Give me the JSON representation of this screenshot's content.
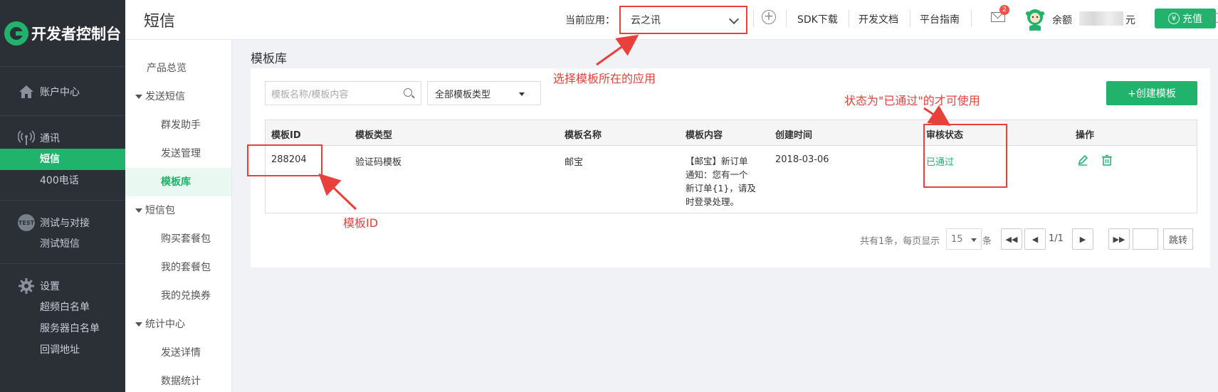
{
  "sidebar": {
    "logo_text": "开发者控制台",
    "groups": [
      {
        "label": "账户中心",
        "icon": "house-icon",
        "items": []
      },
      {
        "label": "通讯",
        "icon": "signal-icon",
        "items": [
          "短信",
          "400电话"
        ]
      },
      {
        "label": "测试与对接",
        "icon": "test-badge-icon",
        "badge": "TEST",
        "items": [
          "测试短信"
        ]
      },
      {
        "label": "设置",
        "icon": "gear-icon",
        "items": [
          "超频白名单",
          "服务器白名单",
          "回调地址"
        ]
      }
    ],
    "active_item": "短信"
  },
  "header": {
    "title": "短信",
    "current_app_label": "当前应用：",
    "current_app_value": "云之讯",
    "links": [
      "SDK下载",
      "开发文档",
      "平台指南"
    ],
    "mail_badge": "2",
    "balance_label": "余额",
    "balance_unit": "元",
    "recharge_label": "充值",
    "recharge_icon_glyph": "¥"
  },
  "submenu": {
    "items": [
      {
        "label": "产品总览",
        "level": 1
      },
      {
        "label": "发送短信",
        "level": 0
      },
      {
        "label": "群发助手",
        "level": 2
      },
      {
        "label": "发送管理",
        "level": 2
      },
      {
        "label": "模板库",
        "level": 2,
        "active": true
      },
      {
        "label": "短信包",
        "level": 0
      },
      {
        "label": "购买套餐包",
        "level": 2
      },
      {
        "label": "我的套餐包",
        "level": 2
      },
      {
        "label": "我的兑换券",
        "level": 2
      },
      {
        "label": "统计中心",
        "level": 0
      },
      {
        "label": "发送详情",
        "level": 2
      },
      {
        "label": "数据统计",
        "level": 2
      }
    ]
  },
  "content": {
    "title": "模板库",
    "search_placeholder": "模板名称/模板内容",
    "type_select": "全部模板类型",
    "create_button": "+创建模板",
    "table": {
      "columns": [
        "模板ID",
        "模板类型",
        "模板名称",
        "模板内容",
        "创建时间",
        "审核状态",
        "操作"
      ],
      "rows": [
        {
          "id": "288204",
          "type": "验证码模板",
          "name": "邮宝",
          "content_lines": [
            "【邮宝】新订单",
            "通知：您有一个",
            "新订单{1}，请及",
            "时登录处理。"
          ],
          "created": "2018-03-06",
          "status": "已通过"
        }
      ]
    },
    "pager": {
      "summary": "共有1条，每页显示",
      "page_size": "15",
      "unit": "条",
      "page": "1/1",
      "first": "◀◀",
      "prev": "◀",
      "next": "▶",
      "last": "▶▶",
      "jump_label": "跳转"
    }
  },
  "annotations": {
    "select_app": "选择模板所在的应用",
    "status_note": "状态为\"已通过\"的才可使用",
    "template_id": "模板ID"
  },
  "colors": {
    "accent": "#21b26b",
    "sidebar": "#2b2f36",
    "annotation": "#e8403b"
  }
}
